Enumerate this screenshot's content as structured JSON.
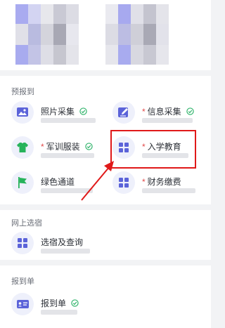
{
  "colors": {
    "accent": "#5b63d9",
    "required_star": "#e24a4a",
    "done_check": "#2fb36a",
    "highlight_box": "#e01919"
  },
  "sections": {
    "prereg": {
      "title": "预报到",
      "items": [
        {
          "label": "照片采集",
          "required": false,
          "done": true,
          "icon": "photo-icon"
        },
        {
          "label": "信息采集",
          "required": true,
          "done": true,
          "icon": "edit-form-icon"
        },
        {
          "label": "军训服装",
          "required": true,
          "done": true,
          "icon": "tshirt-icon"
        },
        {
          "label": "入学教育",
          "required": true,
          "done": false,
          "icon": "grid-icon"
        },
        {
          "label": "绿色通道",
          "required": false,
          "done": false,
          "icon": "green-flag-icon"
        },
        {
          "label": "财务缴费",
          "required": true,
          "done": false,
          "icon": "grid-icon"
        }
      ]
    },
    "dorm": {
      "title": "网上选宿",
      "items": [
        {
          "label": "选宿及查询",
          "required": false,
          "done": false,
          "icon": "grid-icon"
        }
      ]
    },
    "report": {
      "title": "报到单",
      "items": [
        {
          "label": "报到单",
          "required": false,
          "done": true,
          "icon": "id-card-icon"
        }
      ]
    }
  },
  "icons": {
    "check": "check-circle-icon",
    "arrow": "red-pointer-arrow"
  }
}
